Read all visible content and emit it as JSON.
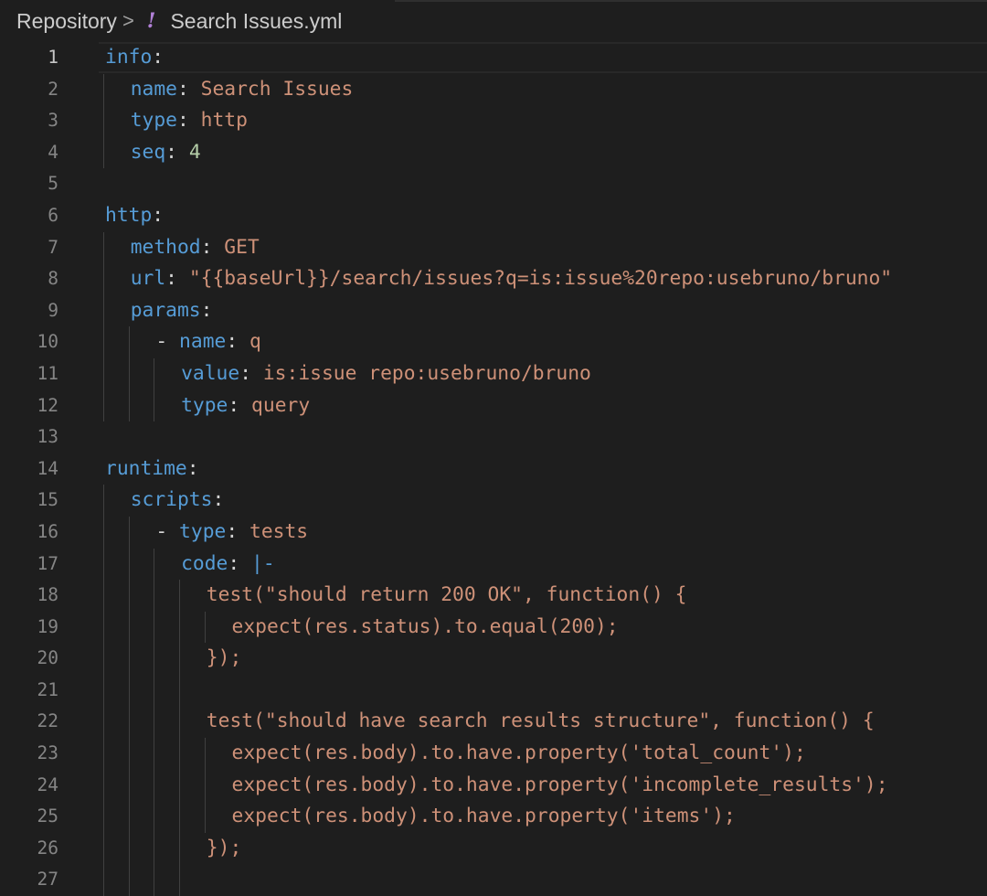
{
  "breadcrumb": {
    "root": "Repository",
    "separator": ">",
    "file_icon": "yaml-exclamation-icon",
    "file": "Search Issues.yml"
  },
  "editor": {
    "active_line": 1,
    "colors": {
      "background": "#1e1e1e",
      "key": "#569cd6",
      "string": "#ce9178",
      "number": "#b5cea8",
      "punctuation": "#d4d4d4",
      "line_number": "#858585",
      "yaml_icon": "#b180d7"
    },
    "lines": [
      {
        "n": "1",
        "indent": 0,
        "tokens": [
          {
            "t": "k",
            "v": "info"
          },
          {
            "t": "p",
            "v": ":"
          }
        ]
      },
      {
        "n": "2",
        "indent": 1,
        "tokens": [
          {
            "t": "k",
            "v": "name"
          },
          {
            "t": "p",
            "v": ": "
          },
          {
            "t": "s",
            "v": "Search Issues"
          }
        ]
      },
      {
        "n": "3",
        "indent": 1,
        "tokens": [
          {
            "t": "k",
            "v": "type"
          },
          {
            "t": "p",
            "v": ": "
          },
          {
            "t": "s",
            "v": "http"
          }
        ]
      },
      {
        "n": "4",
        "indent": 1,
        "tokens": [
          {
            "t": "k",
            "v": "seq"
          },
          {
            "t": "p",
            "v": ": "
          },
          {
            "t": "n",
            "v": "4"
          }
        ]
      },
      {
        "n": "5",
        "indent": 0,
        "tokens": []
      },
      {
        "n": "6",
        "indent": 0,
        "tokens": [
          {
            "t": "k",
            "v": "http"
          },
          {
            "t": "p",
            "v": ":"
          }
        ]
      },
      {
        "n": "7",
        "indent": 1,
        "tokens": [
          {
            "t": "k",
            "v": "method"
          },
          {
            "t": "p",
            "v": ": "
          },
          {
            "t": "s",
            "v": "GET"
          }
        ]
      },
      {
        "n": "8",
        "indent": 1,
        "tokens": [
          {
            "t": "k",
            "v": "url"
          },
          {
            "t": "p",
            "v": ": "
          },
          {
            "t": "s",
            "v": "\"{{baseUrl}}/search/issues?q=is:issue%20repo:usebruno/bruno\""
          }
        ]
      },
      {
        "n": "9",
        "indent": 1,
        "tokens": [
          {
            "t": "k",
            "v": "params"
          },
          {
            "t": "p",
            "v": ":"
          }
        ]
      },
      {
        "n": "10",
        "indent": 2,
        "tokens": [
          {
            "t": "p",
            "v": "- "
          },
          {
            "t": "k",
            "v": "name"
          },
          {
            "t": "p",
            "v": ": "
          },
          {
            "t": "s",
            "v": "q"
          }
        ]
      },
      {
        "n": "11",
        "indent": 3,
        "tokens": [
          {
            "t": "k",
            "v": "value"
          },
          {
            "t": "p",
            "v": ": "
          },
          {
            "t": "s",
            "v": "is:issue repo:usebruno/bruno"
          }
        ]
      },
      {
        "n": "12",
        "indent": 3,
        "tokens": [
          {
            "t": "k",
            "v": "type"
          },
          {
            "t": "p",
            "v": ": "
          },
          {
            "t": "s",
            "v": "query"
          }
        ]
      },
      {
        "n": "13",
        "indent": 0,
        "tokens": []
      },
      {
        "n": "14",
        "indent": 0,
        "tokens": [
          {
            "t": "k",
            "v": "runtime"
          },
          {
            "t": "p",
            "v": ":"
          }
        ]
      },
      {
        "n": "15",
        "indent": 1,
        "tokens": [
          {
            "t": "k",
            "v": "scripts"
          },
          {
            "t": "p",
            "v": ":"
          }
        ]
      },
      {
        "n": "16",
        "indent": 2,
        "tokens": [
          {
            "t": "p",
            "v": "- "
          },
          {
            "t": "k",
            "v": "type"
          },
          {
            "t": "p",
            "v": ": "
          },
          {
            "t": "s",
            "v": "tests"
          }
        ]
      },
      {
        "n": "17",
        "indent": 3,
        "tokens": [
          {
            "t": "k",
            "v": "code"
          },
          {
            "t": "p",
            "v": ": "
          },
          {
            "t": "k",
            "v": "|-"
          }
        ]
      },
      {
        "n": "18",
        "indent": 4,
        "tokens": [
          {
            "t": "s",
            "v": "test(\"should return 200 OK\", function() {"
          }
        ]
      },
      {
        "n": "19",
        "indent": 5,
        "tokens": [
          {
            "t": "s",
            "v": "expect(res.status).to.equal(200);"
          }
        ]
      },
      {
        "n": "20",
        "indent": 4,
        "tokens": [
          {
            "t": "s",
            "v": "});"
          }
        ]
      },
      {
        "n": "21",
        "indent": 4,
        "tokens": []
      },
      {
        "n": "22",
        "indent": 4,
        "tokens": [
          {
            "t": "s",
            "v": "test(\"should have search results structure\", function() {"
          }
        ]
      },
      {
        "n": "23",
        "indent": 5,
        "tokens": [
          {
            "t": "s",
            "v": "expect(res.body).to.have.property('total_count');"
          }
        ]
      },
      {
        "n": "24",
        "indent": 5,
        "tokens": [
          {
            "t": "s",
            "v": "expect(res.body).to.have.property('incomplete_results');"
          }
        ]
      },
      {
        "n": "25",
        "indent": 5,
        "tokens": [
          {
            "t": "s",
            "v": "expect(res.body).to.have.property('items');"
          }
        ]
      },
      {
        "n": "26",
        "indent": 4,
        "tokens": [
          {
            "t": "s",
            "v": "});"
          }
        ]
      },
      {
        "n": "27",
        "indent": 4,
        "tokens": []
      }
    ]
  }
}
